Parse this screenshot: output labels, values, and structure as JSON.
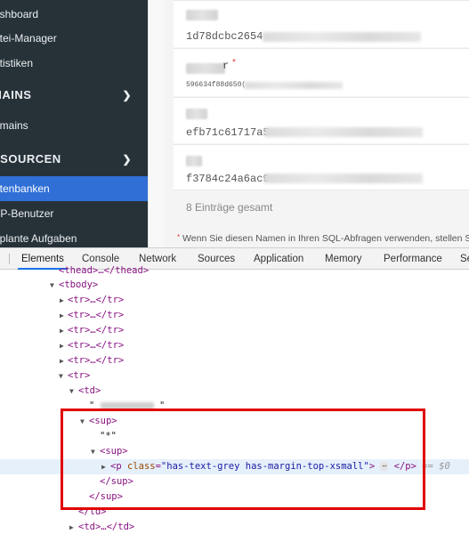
{
  "sidebar": {
    "items": [
      {
        "label": "ashboard"
      },
      {
        "label": "atei-Manager"
      },
      {
        "label": "atistiken"
      },
      {
        "label": "MAINS"
      },
      {
        "label": "omains"
      },
      {
        "label": "SSOURCEN"
      },
      {
        "label": "atenbanken"
      },
      {
        "label": "TP-Benutzer"
      },
      {
        "label": "eplante Aufgaben"
      }
    ],
    "chevron": "chevron-down-icon"
  },
  "content": {
    "rows": [
      {
        "hash": "1d78dcbc2654"
      },
      {
        "name_suffix": "r",
        "required_mark": "*",
        "hash": "596634f88d650("
      },
      {
        "hash": "efb71c61717a5"
      },
      {
        "hash": "f3784c24a6ac9"
      }
    ],
    "entries_text": "8 Einträge gesamt",
    "note_star": "*",
    "note_text": "Wenn Sie diesen Namen in Ihren SQL-Abfragen verwenden, stellen S"
  },
  "devtools": {
    "tabs": [
      {
        "label": "Elements"
      },
      {
        "label": "Console"
      },
      {
        "label": "Network"
      },
      {
        "label": "Sources"
      },
      {
        "label": "Application"
      },
      {
        "label": "Memory"
      },
      {
        "label": "Performance"
      },
      {
        "label": "Se"
      }
    ],
    "tree": {
      "thead_line": "<thead>…</thead>",
      "tbody_open": "<tbody>",
      "tr_collapsed": "<tr>…</tr>",
      "tr_open": "<tr>",
      "td_open": "<td>",
      "sup_open": "<sup>",
      "star_text": "\"*\"",
      "p_line_tag": "p",
      "p_class_attr": "class",
      "p_class_val": "\"has-text-grey has-margin-top-xsmall\"",
      "p_close": "</p>",
      "dollar": "== $0",
      "sup_close": "</sup>",
      "td_close": "</td>",
      "td_collapsed": "<td>…</td>"
    }
  }
}
